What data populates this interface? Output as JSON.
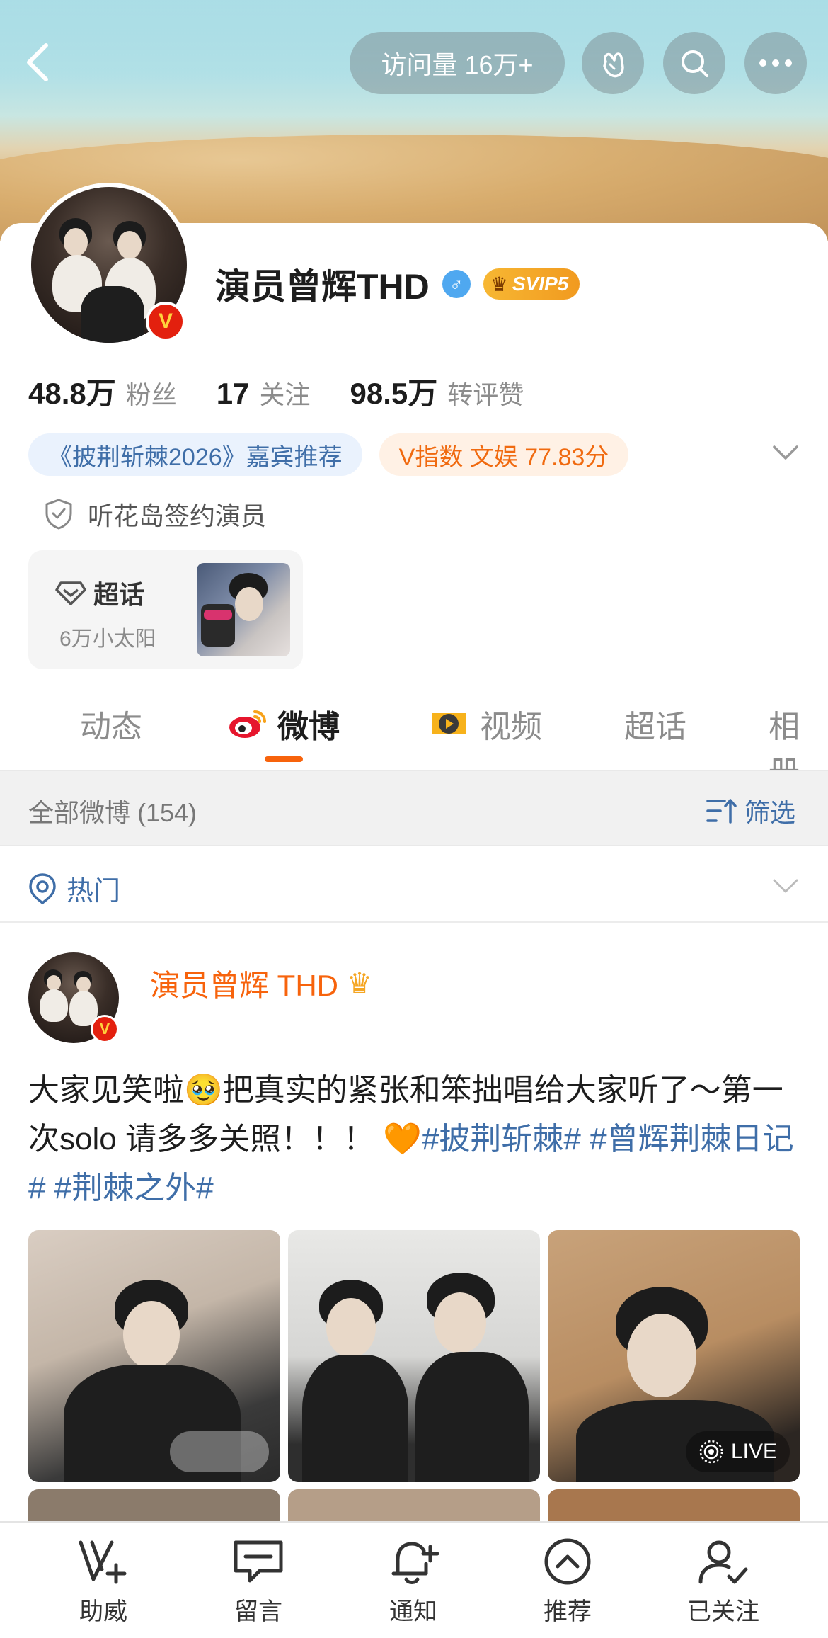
{
  "header": {
    "visit_label": "访问量 16万+"
  },
  "profile": {
    "name": "演员曾辉THD",
    "gender_icon": "male-icon",
    "svip_label": "SVIP5",
    "stats": [
      {
        "num": "48.8万",
        "label": "粉丝"
      },
      {
        "num": "17",
        "label": "关注"
      },
      {
        "num": "98.5万",
        "label": "转评赞"
      }
    ],
    "tag_recommend": "《披荆斩棘2026》嘉宾推荐",
    "tag_vindex": "V指数 文娱 77.83分",
    "signed_text": "听花岛签约演员",
    "chaohua_title": "超话",
    "chaohua_sub": "6万小太阳"
  },
  "tabs": [
    {
      "label": "动态"
    },
    {
      "label": "微博"
    },
    {
      "label": "视频"
    },
    {
      "label": "超话"
    },
    {
      "label": "相册"
    }
  ],
  "feed": {
    "count_label": "全部微博 (154)",
    "filter_label": "筛选",
    "hot_label": "热门"
  },
  "post": {
    "author": "演员曾辉 THD",
    "text_main": "大家见笑啦🥹把真实的紧张和笨拙唱给大家听了～第一次solo 请多多关照！！！ 🧡",
    "hashtags": [
      "#披荆斩棘#",
      "#曾辉荆棘日记#",
      "#荆棘之外#"
    ],
    "live_label": "LIVE"
  },
  "bottom_nav": [
    {
      "label": "助威"
    },
    {
      "label": "留言"
    },
    {
      "label": "通知"
    },
    {
      "label": "推荐"
    },
    {
      "label": "已关注"
    }
  ],
  "colors": {
    "accent_orange": "#f7630c",
    "link_blue": "#3f6ea8",
    "vip_red": "#e3200e"
  }
}
